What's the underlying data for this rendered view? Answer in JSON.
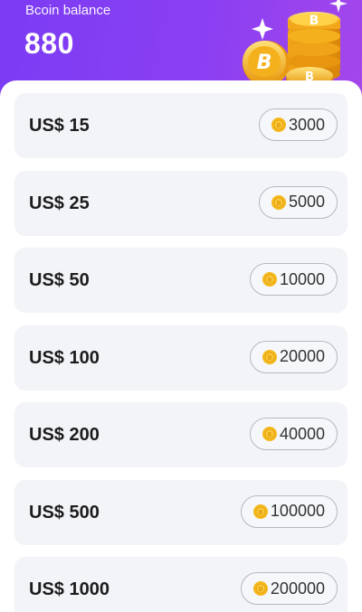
{
  "header": {
    "balance_label": "Bcoin balance",
    "balance_value": "880"
  },
  "packages": [
    {
      "price": "US$ 15",
      "coins": "3000"
    },
    {
      "price": "US$ 25",
      "coins": "5000"
    },
    {
      "price": "US$ 50",
      "coins": "10000"
    },
    {
      "price": "US$ 100",
      "coins": "20000"
    },
    {
      "price": "US$ 200",
      "coins": "40000"
    },
    {
      "price": "US$ 500",
      "coins": "100000"
    },
    {
      "price": "US$ 1000",
      "coins": "200000"
    }
  ],
  "colors": {
    "header_gradient_start": "#7b3cf4",
    "header_gradient_end": "#b14be7",
    "card_background": "#f3f4f8",
    "coin_gold": "#f5b81c"
  },
  "icons": {
    "header_art": "coin-stack-icon",
    "pill_coin": "bcoin-icon"
  }
}
